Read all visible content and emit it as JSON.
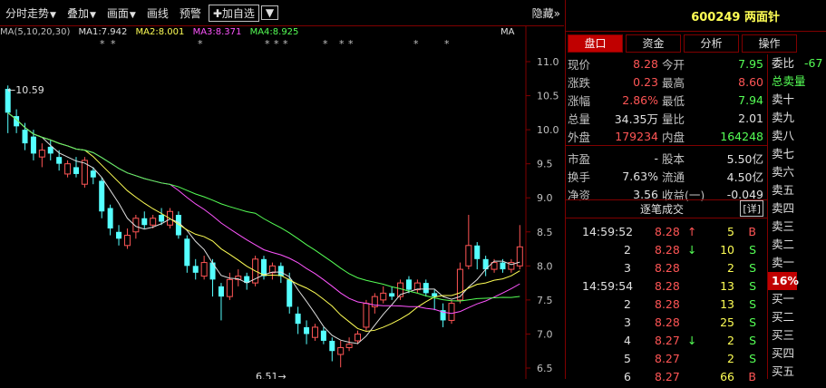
{
  "toolbar": {
    "items": [
      "分时走势",
      "叠加",
      "画面",
      "画线",
      "预警"
    ],
    "add_self": "✚加自选",
    "hide": "隐藏»"
  },
  "ma_bar": {
    "params": "MA(5,10,20,30)",
    "ma1": "MA1:7.942",
    "ma2": "MA2:8.001",
    "ma3": "MA3:8.371",
    "ma4": "MA4:8.925",
    "right_label": "MA"
  },
  "chart_data": {
    "type": "candlestick",
    "y_axis_ticks": [
      "11.0",
      "10.5",
      "10.0",
      "9.5",
      "9.0",
      "8.5",
      "8.0",
      "7.5",
      "7.0",
      "6.5"
    ],
    "ylim": [
      6.5,
      11.0
    ],
    "high_label": "10.59",
    "low_label": "6.51",
    "candles": [
      [
        10.6,
        10.25,
        10.65,
        9.95
      ],
      [
        10.2,
        10.05,
        10.3,
        9.95
      ],
      [
        10.0,
        9.8,
        10.1,
        9.7
      ],
      [
        9.9,
        9.65,
        10.0,
        9.55
      ],
      [
        9.6,
        9.7,
        9.8,
        9.45
      ],
      [
        9.75,
        9.65,
        9.85,
        9.55
      ],
      [
        9.6,
        9.5,
        9.7,
        9.4
      ],
      [
        9.35,
        9.5,
        9.55,
        9.3
      ],
      [
        9.45,
        9.35,
        9.6,
        9.3
      ],
      [
        9.2,
        9.55,
        9.6,
        9.15
      ],
      [
        9.4,
        9.3,
        9.45,
        9.2
      ],
      [
        9.25,
        8.8,
        9.3,
        8.7
      ],
      [
        8.85,
        8.55,
        8.9,
        8.45
      ],
      [
        8.5,
        8.4,
        8.6,
        8.3
      ],
      [
        8.3,
        8.45,
        8.55,
        8.25
      ],
      [
        8.5,
        8.7,
        8.75,
        8.4
      ],
      [
        8.7,
        8.6,
        8.8,
        8.55
      ],
      [
        8.6,
        8.7,
        8.75,
        8.55
      ],
      [
        8.75,
        8.65,
        8.85,
        8.6
      ],
      [
        8.6,
        8.8,
        8.85,
        8.55
      ],
      [
        8.75,
        8.45,
        8.8,
        8.4
      ],
      [
        8.4,
        8.0,
        8.45,
        7.9
      ],
      [
        8.0,
        7.9,
        8.1,
        7.8
      ],
      [
        7.85,
        8.05,
        8.15,
        7.8
      ],
      [
        8.05,
        7.8,
        8.1,
        7.55
      ],
      [
        7.7,
        7.55,
        7.75,
        7.2
      ],
      [
        7.55,
        7.8,
        7.9,
        7.5
      ],
      [
        7.8,
        7.85,
        7.95,
        7.7
      ],
      [
        7.85,
        7.75,
        7.9,
        7.65
      ],
      [
        7.75,
        8.1,
        8.15,
        7.7
      ],
      [
        8.1,
        7.85,
        8.15,
        7.8
      ],
      [
        7.9,
        8.0,
        8.05,
        7.8
      ],
      [
        8.0,
        7.85,
        8.05,
        7.75
      ],
      [
        7.8,
        7.4,
        7.9,
        7.3
      ],
      [
        7.3,
        7.15,
        7.4,
        7.0
      ],
      [
        7.1,
        7.0,
        7.2,
        6.85
      ],
      [
        6.95,
        7.1,
        7.15,
        6.9
      ],
      [
        7.05,
        6.9,
        7.1,
        6.85
      ],
      [
        6.9,
        6.75,
        6.95,
        6.6
      ],
      [
        6.7,
        6.8,
        6.9,
        6.51
      ],
      [
        6.8,
        6.85,
        6.95,
        6.75
      ],
      [
        6.9,
        7.0,
        7.05,
        6.85
      ],
      [
        7.1,
        7.45,
        7.5,
        7.05
      ],
      [
        7.4,
        7.55,
        7.6,
        7.3
      ],
      [
        7.5,
        7.6,
        7.7,
        7.45
      ],
      [
        7.6,
        7.55,
        7.7,
        7.5
      ],
      [
        7.55,
        7.75,
        7.8,
        7.5
      ],
      [
        7.8,
        7.65,
        7.85,
        7.6
      ],
      [
        7.65,
        7.75,
        7.8,
        7.6
      ],
      [
        7.75,
        7.6,
        7.8,
        7.55
      ],
      [
        7.6,
        7.55,
        7.65,
        7.35
      ],
      [
        7.35,
        7.2,
        7.45,
        7.1
      ],
      [
        7.2,
        7.45,
        7.5,
        7.15
      ],
      [
        7.5,
        7.95,
        8.05,
        7.45
      ],
      [
        8.0,
        8.3,
        8.75,
        7.95
      ],
      [
        8.3,
        8.1,
        8.35,
        7.95
      ],
      [
        8.1,
        7.95,
        8.15,
        7.85
      ],
      [
        7.95,
        8.05,
        8.1,
        7.9
      ],
      [
        8.05,
        7.95,
        8.1,
        7.9
      ],
      [
        7.95,
        8.05,
        8.1,
        7.9
      ],
      [
        8.0,
        8.28,
        8.6,
        7.95
      ]
    ]
  },
  "right": {
    "stock_code": "600249 两面针",
    "tabs": [
      "盘口",
      "资金",
      "分析",
      "操作"
    ],
    "quote": [
      {
        "l1": "现价",
        "v1": "8.28",
        "c1": "red",
        "l2": "今开",
        "v2": "7.95",
        "c2": "green"
      },
      {
        "l1": "涨跌",
        "v1": "0.23",
        "c1": "red",
        "l2": "最高",
        "v2": "8.60",
        "c2": "red"
      },
      {
        "l1": "涨幅",
        "v1": "2.86%",
        "c1": "red",
        "l2": "最低",
        "v2": "7.94",
        "c2": "green"
      },
      {
        "l1": "总量",
        "v1": "34.35万",
        "c1": "white",
        "l2": "量比",
        "v2": "2.01",
        "c2": "white"
      },
      {
        "l1": "外盘",
        "v1": "179234",
        "c1": "red",
        "l2": "内盘",
        "v2": "164248",
        "c2": "green"
      },
      {
        "l1": "市盈",
        "v1": "-",
        "c1": "white",
        "l2": "股本",
        "v2": "5.50亿",
        "c2": "white"
      },
      {
        "l1": "换手",
        "v1": "7.63%",
        "c1": "white",
        "l2": "流通",
        "v2": "4.50亿",
        "c2": "white"
      },
      {
        "l1": "净资",
        "v1": "3.56",
        "c1": "white",
        "l2": "收益(一)",
        "v2": "-0.049",
        "c2": "white"
      }
    ],
    "trades_title": "逐笔成交",
    "detail": "[详]",
    "trades": [
      {
        "t": "14:59:52",
        "p": "8.28",
        "pc": "red",
        "arr": "↑",
        "ac": "red",
        "v": "5",
        "s": "B",
        "sc": "red"
      },
      {
        "t": "2",
        "p": "8.28",
        "pc": "red",
        "arr": "↓",
        "ac": "green",
        "v": "10",
        "s": "S",
        "sc": "green"
      },
      {
        "t": "3",
        "p": "8.28",
        "pc": "red",
        "arr": "",
        "ac": "red",
        "v": "2",
        "s": "S",
        "sc": "green"
      },
      {
        "t": "14:59:54",
        "p": "8.28",
        "pc": "red",
        "arr": "",
        "ac": "red",
        "v": "13",
        "s": "S",
        "sc": "green"
      },
      {
        "t": "2",
        "p": "8.28",
        "pc": "red",
        "arr": "",
        "ac": "red",
        "v": "13",
        "s": "S",
        "sc": "green"
      },
      {
        "t": "3",
        "p": "8.28",
        "pc": "red",
        "arr": "",
        "ac": "red",
        "v": "25",
        "s": "S",
        "sc": "green"
      },
      {
        "t": "4",
        "p": "8.27",
        "pc": "red",
        "arr": "↓",
        "ac": "green",
        "v": "2",
        "s": "S",
        "sc": "green"
      },
      {
        "t": "5",
        "p": "8.27",
        "pc": "red",
        "arr": "",
        "ac": "red",
        "v": "2",
        "s": "S",
        "sc": "green"
      },
      {
        "t": "6",
        "p": "8.27",
        "pc": "red",
        "arr": "",
        "ac": "red",
        "v": "66",
        "s": "B",
        "sc": "red"
      }
    ],
    "side": {
      "weibi_label": "委比",
      "weibi_value": "-67",
      "total_sell": "总卖量",
      "rows": [
        "卖十",
        "卖九",
        "卖八",
        "卖七",
        "卖六",
        "卖五",
        "卖四",
        "卖三",
        "卖二",
        "卖一"
      ],
      "pct": "16%",
      "buy_rows": [
        "买一",
        "买二",
        "买三",
        "买四",
        "买五"
      ]
    }
  }
}
